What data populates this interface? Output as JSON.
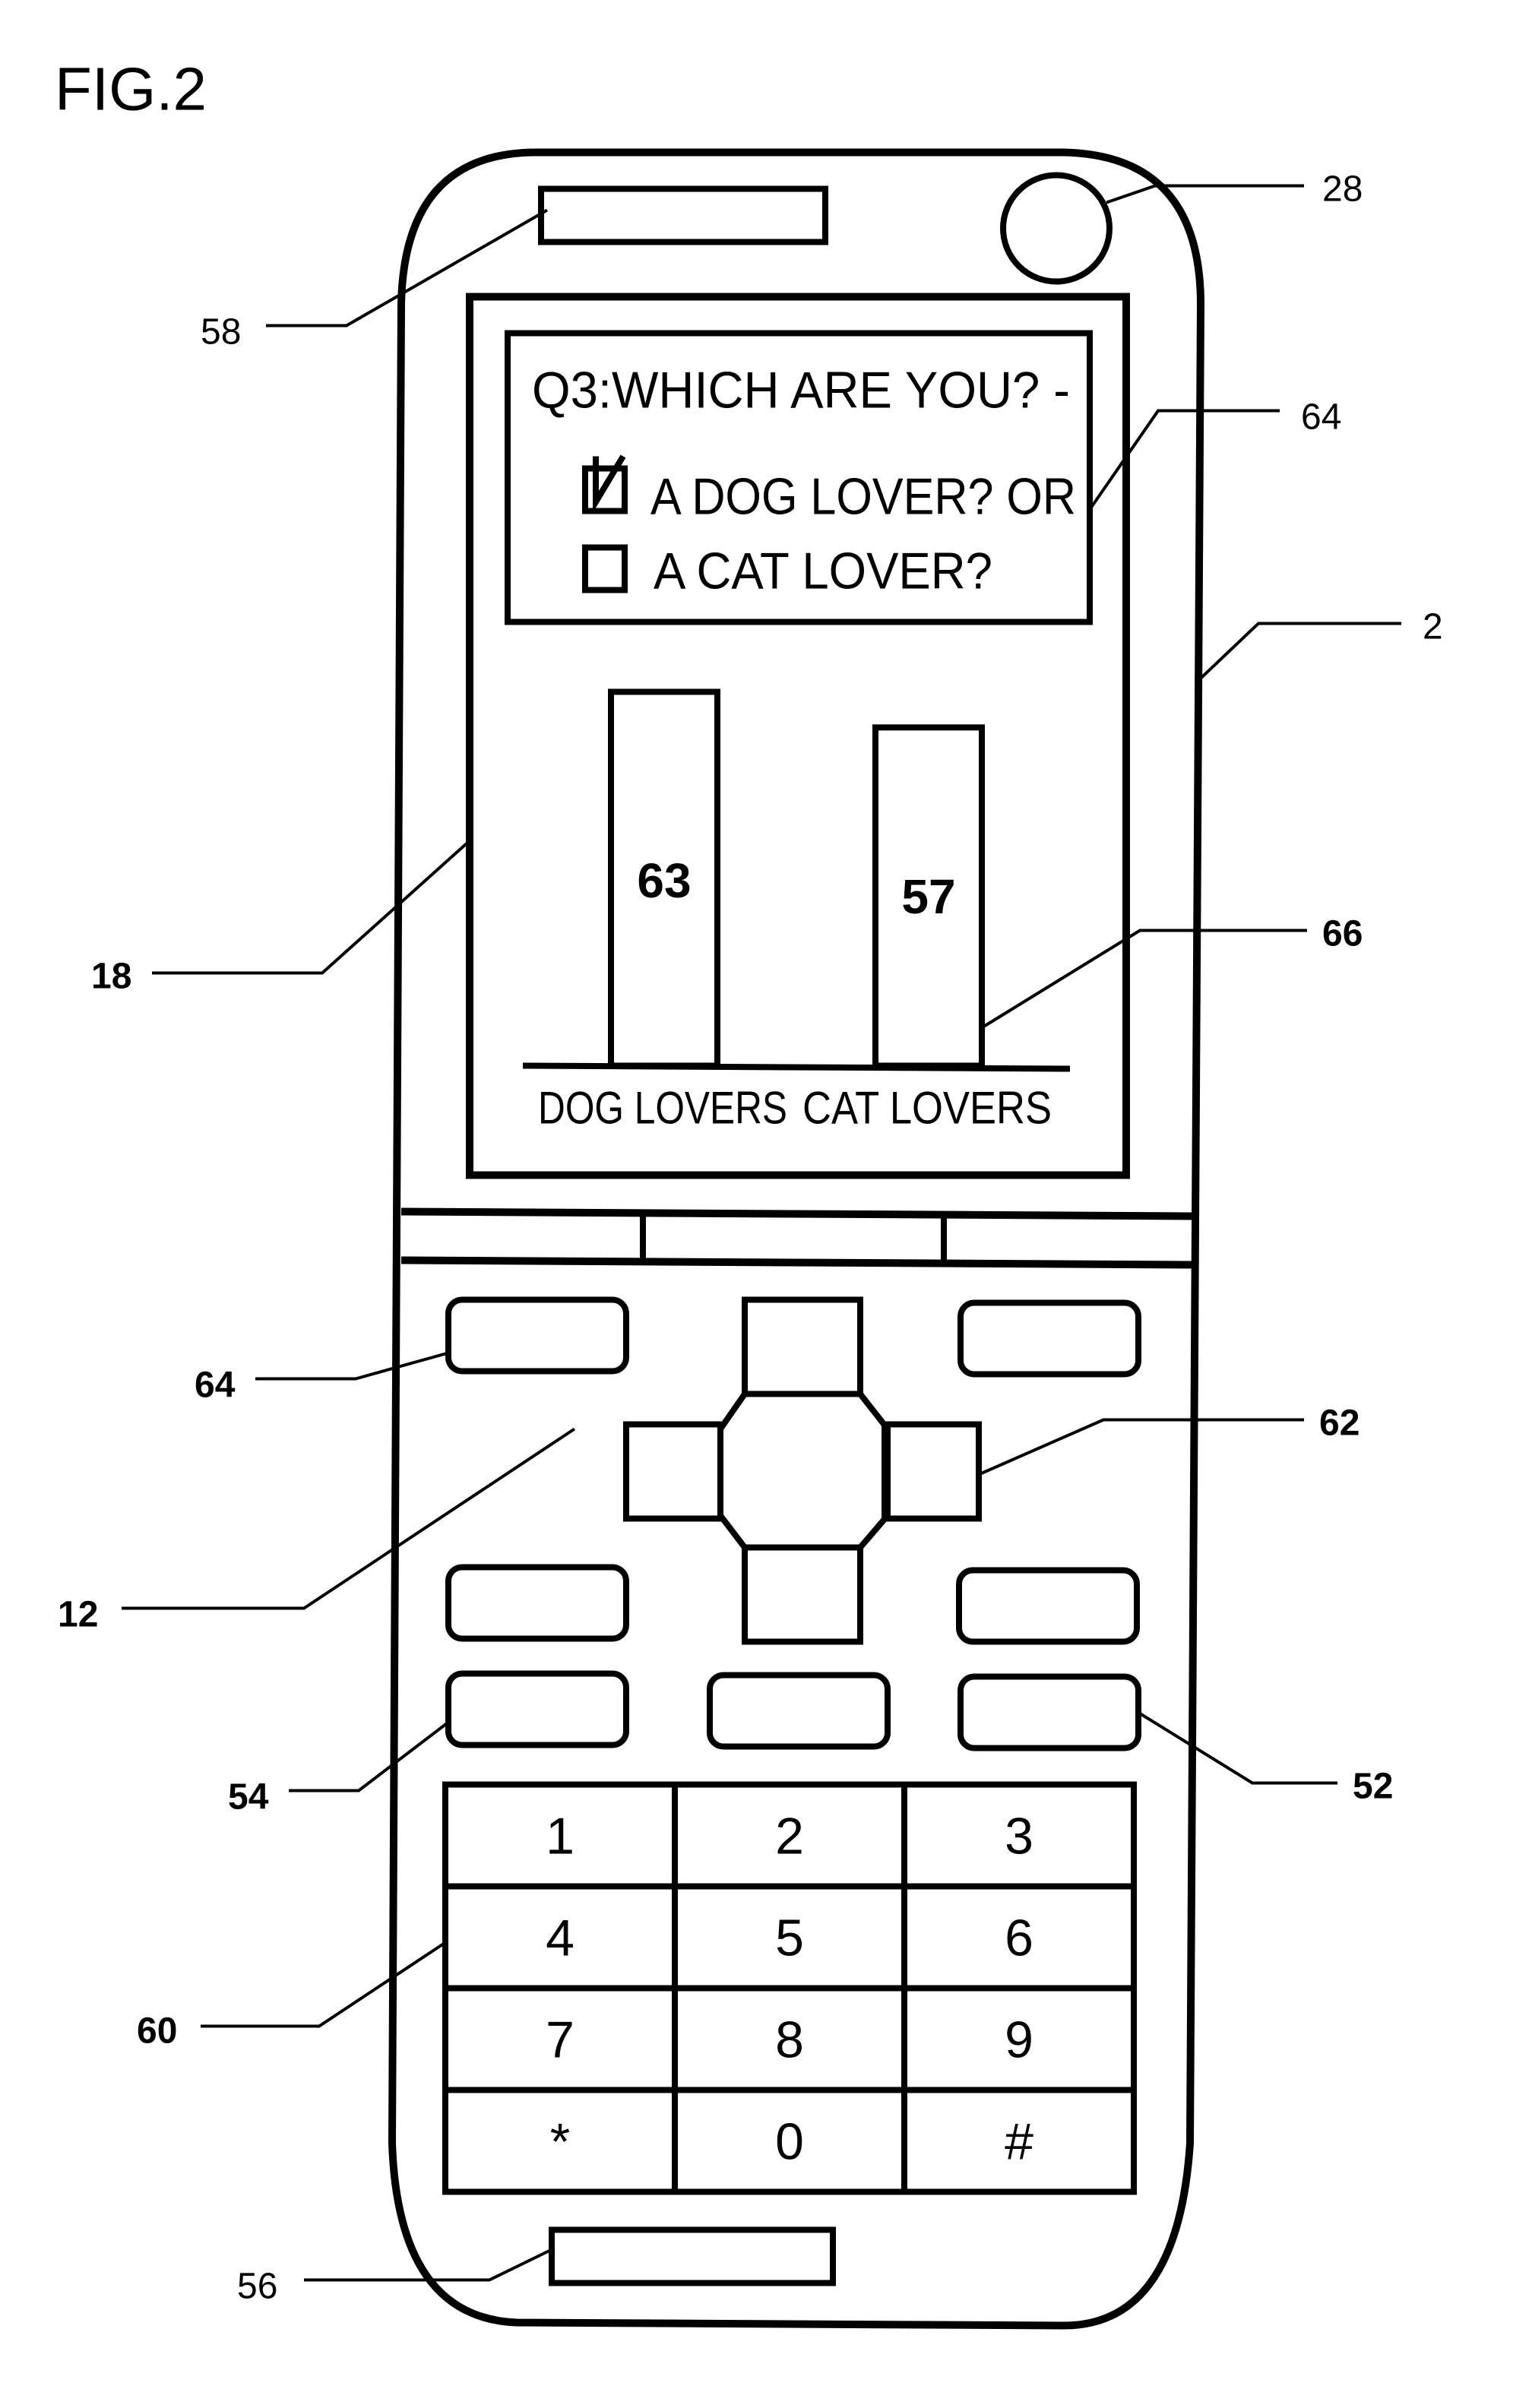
{
  "figure": {
    "title": "FIG.2"
  },
  "reference_numerals": {
    "phone_body": "2",
    "camera": "28",
    "upper_speaker": "58",
    "display": "18",
    "survey_selection": "64",
    "result_graph": "66",
    "lower_housing": "12",
    "soft_key": "64",
    "cross_key": "62",
    "side_key_left": "54",
    "side_key_right": "52",
    "numeric_keypad": "60",
    "microphone": "56"
  },
  "screen": {
    "question": "Q3:WHICH ARE YOU? -",
    "options": [
      {
        "label": "A DOG LOVER? OR",
        "checked": true
      },
      {
        "label": "A CAT LOVER?",
        "checked": false
      }
    ]
  },
  "chart_data": {
    "type": "bar",
    "title": "",
    "categories": [
      "DOG LOVERS",
      "CAT LOVERS"
    ],
    "values": [
      63,
      57
    ],
    "data_labels": [
      "63",
      "57"
    ],
    "xlabel": "",
    "ylabel": "",
    "ylim": [
      0,
      67
    ],
    "grid": false
  },
  "keypad": {
    "keys": [
      "1",
      "2",
      "3",
      "4",
      "5",
      "6",
      "7",
      "8",
      "9",
      "*",
      "0",
      "#"
    ]
  }
}
